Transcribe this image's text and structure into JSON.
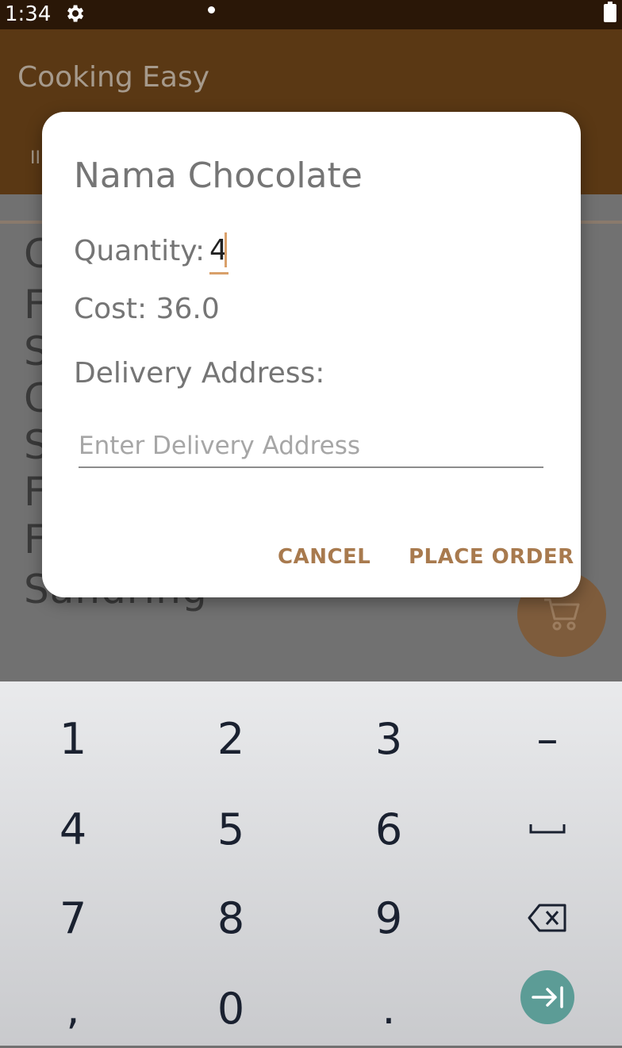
{
  "status_bar": {
    "time": "1:34",
    "icons": [
      "gear-icon",
      "notification-dot-icon",
      "battery-icon"
    ]
  },
  "app_bar": {
    "title": "Cooking Easy",
    "tab_peek": "II"
  },
  "background_list": {
    "letters": [
      "C",
      "F",
      "S",
      "C",
      "S",
      "F",
      "F"
    ],
    "last_item": "Sandring"
  },
  "fab": {
    "icon": "cart-icon",
    "color": "#7e5c3c"
  },
  "dialog": {
    "title": "Nama Chocolate",
    "quantity_label": "Quantity:",
    "quantity_value": "4",
    "cost_text": "Cost: 36.0",
    "address_label": "Delivery Address:",
    "address_placeholder": "Enter Delivery Address",
    "address_value": "",
    "cancel_label": "CANCEL",
    "place_order_label": "PLACE ORDER",
    "accent_color": "#a87a4e"
  },
  "keyboard": {
    "rows": [
      [
        "1",
        "2",
        "3",
        "–"
      ],
      [
        "4",
        "5",
        "6",
        "␣"
      ],
      [
        "7",
        "8",
        "9",
        "⌫"
      ],
      [
        ",",
        "0",
        ".",
        "⇥"
      ]
    ],
    "enter_color": "#5c9c96"
  }
}
